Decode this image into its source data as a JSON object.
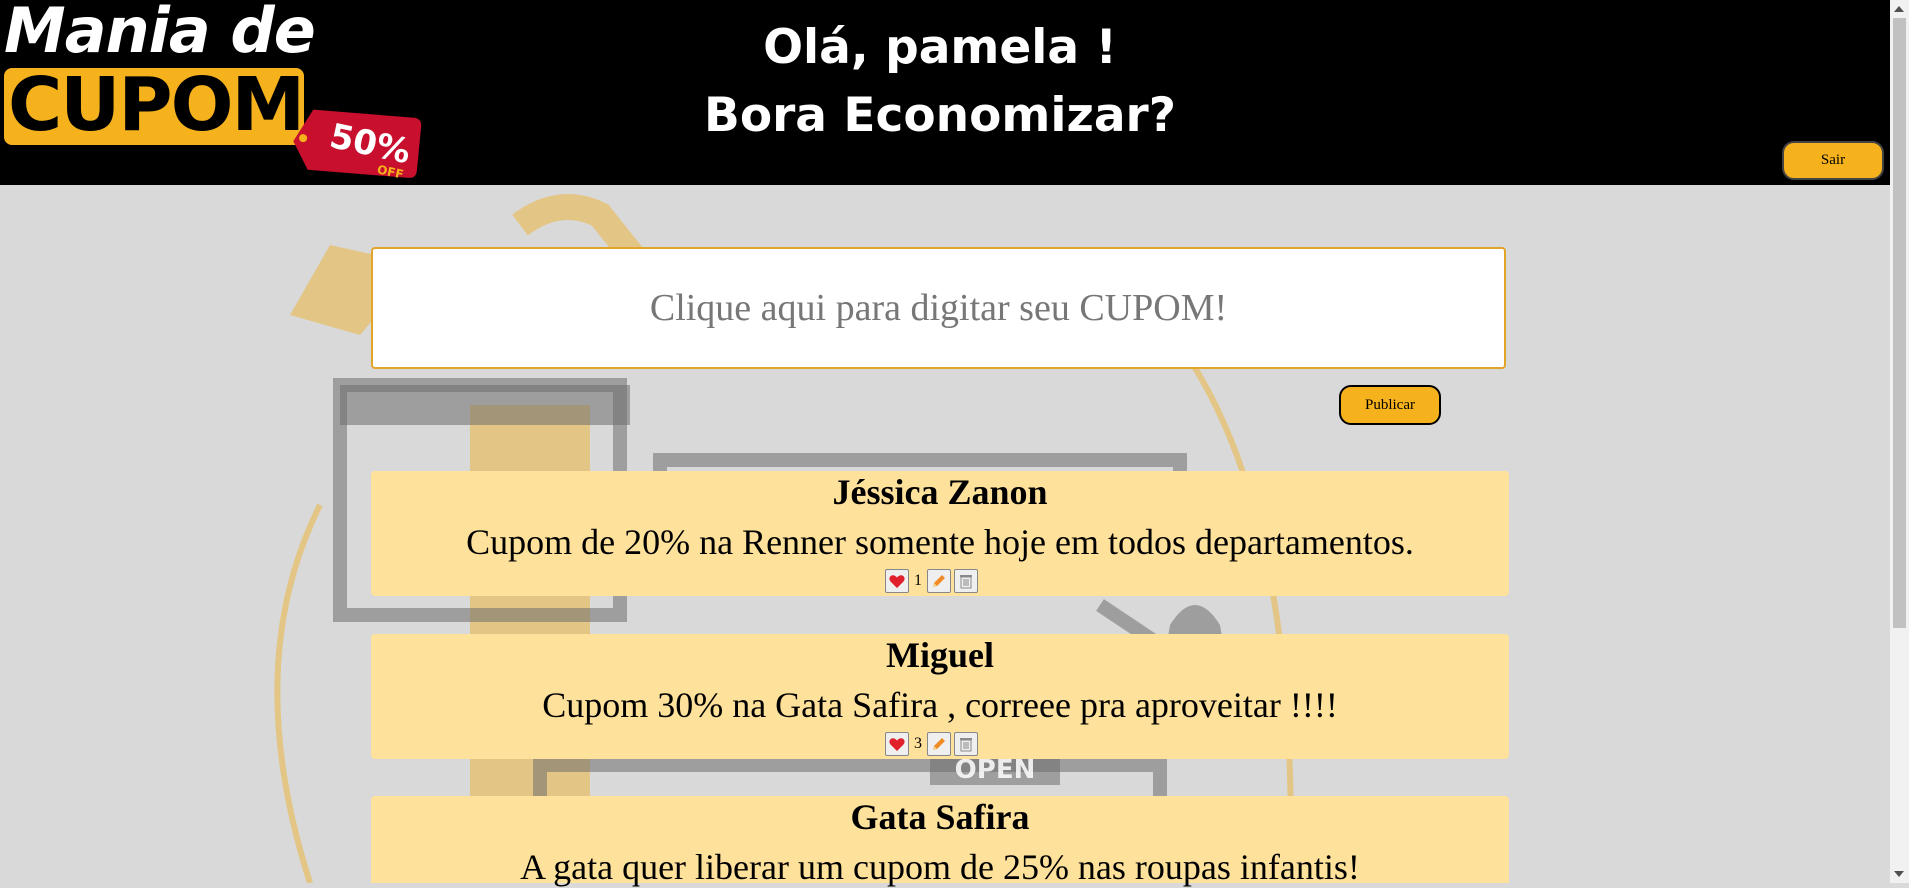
{
  "header": {
    "logo_line1": "Mania de",
    "logo_line2": "CUPOM",
    "logo_tag_pct": "50%",
    "logo_tag_off": "OFF",
    "greeting_line1": "Olá, pamela !",
    "greeting_line2": "Bora Economizar?",
    "logout_label": "Sair"
  },
  "composer": {
    "placeholder": "Clique aqui para digitar seu CUPOM!",
    "value": "",
    "publish_label": "Publicar"
  },
  "background": {
    "open_sign": "OPEN"
  },
  "posts": [
    {
      "author": "Jéssica Zanon",
      "text": "Cupom de 20% na Renner somente hoje em todos departamentos.",
      "likes": "1"
    },
    {
      "author": "Miguel",
      "text": "Cupom 30% na Gata Safira , correee pra aproveitar !!!!",
      "likes": "3"
    },
    {
      "author": "Gata Safira",
      "text": "A gata quer liberar um cupom de 25% nas roupas infantis!",
      "likes": ""
    }
  ],
  "colors": {
    "header_bg": "#000000",
    "accent_yellow": "#f6b21c",
    "post_bg": "#fee19b",
    "page_bg": "#d9d9d9",
    "input_border": "#e3a42a"
  },
  "icons": [
    "heart-icon",
    "pencil-icon",
    "trash-icon"
  ]
}
